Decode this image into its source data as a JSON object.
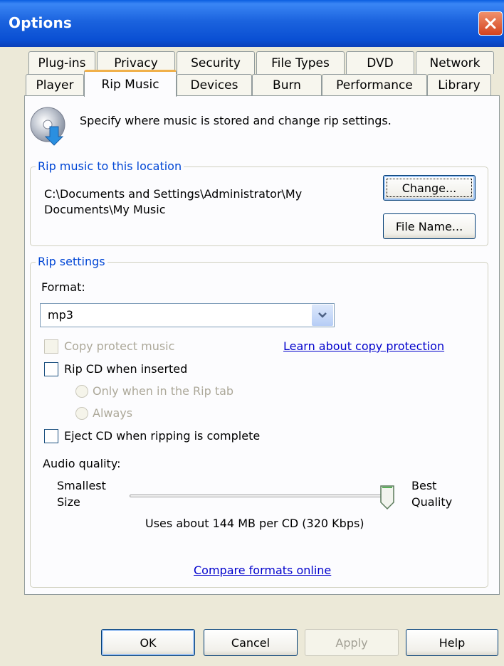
{
  "window": {
    "title": "Options"
  },
  "tabs": {
    "row1": [
      "Plug-ins",
      "Privacy",
      "Security",
      "File Types",
      "DVD",
      "Network"
    ],
    "row2": [
      "Player",
      "Rip Music",
      "Devices",
      "Burn",
      "Performance",
      "Library"
    ],
    "active": "Rip Music"
  },
  "intro": {
    "text": "Specify where music is stored and change rip settings.",
    "icon": "cd-rip-icon"
  },
  "location_group": {
    "legend": "Rip music to this location",
    "path": "C:\\Documents and Settings\\Administrator\\My Documents\\My Music",
    "change_button": "Change...",
    "filename_button": "File Name..."
  },
  "rip_settings": {
    "legend": "Rip settings",
    "format_label": "Format:",
    "format_value": "mp3",
    "copy_protect_label": "Copy protect music",
    "copy_protect_checked": false,
    "learn_link": "Learn about copy protection",
    "rip_cd_label": "Rip CD when inserted",
    "rip_cd_checked": false,
    "radio_only_rip_tab": "Only when in the Rip tab",
    "radio_always": "Always",
    "eject_label": "Eject CD when ripping is complete",
    "eject_checked": false,
    "audio_quality_label": "Audio quality:",
    "smallest_label": "Smallest",
    "size_label": "Size",
    "best_label": "Best",
    "quality_label": "Quality",
    "quality_level": 1.0,
    "usage_text": "Uses about 144 MB per CD (320 Kbps)",
    "compare_link": "Compare formats online"
  },
  "buttons": {
    "ok": "OK",
    "cancel": "Cancel",
    "apply": "Apply",
    "help": "Help"
  },
  "colors": {
    "title_bar": "#0a4fd3",
    "dialog_bg": "#ece9d8",
    "legend_text": "#0046d5",
    "link": "#0000cc",
    "active_tab_accent": "#f0b04a"
  }
}
